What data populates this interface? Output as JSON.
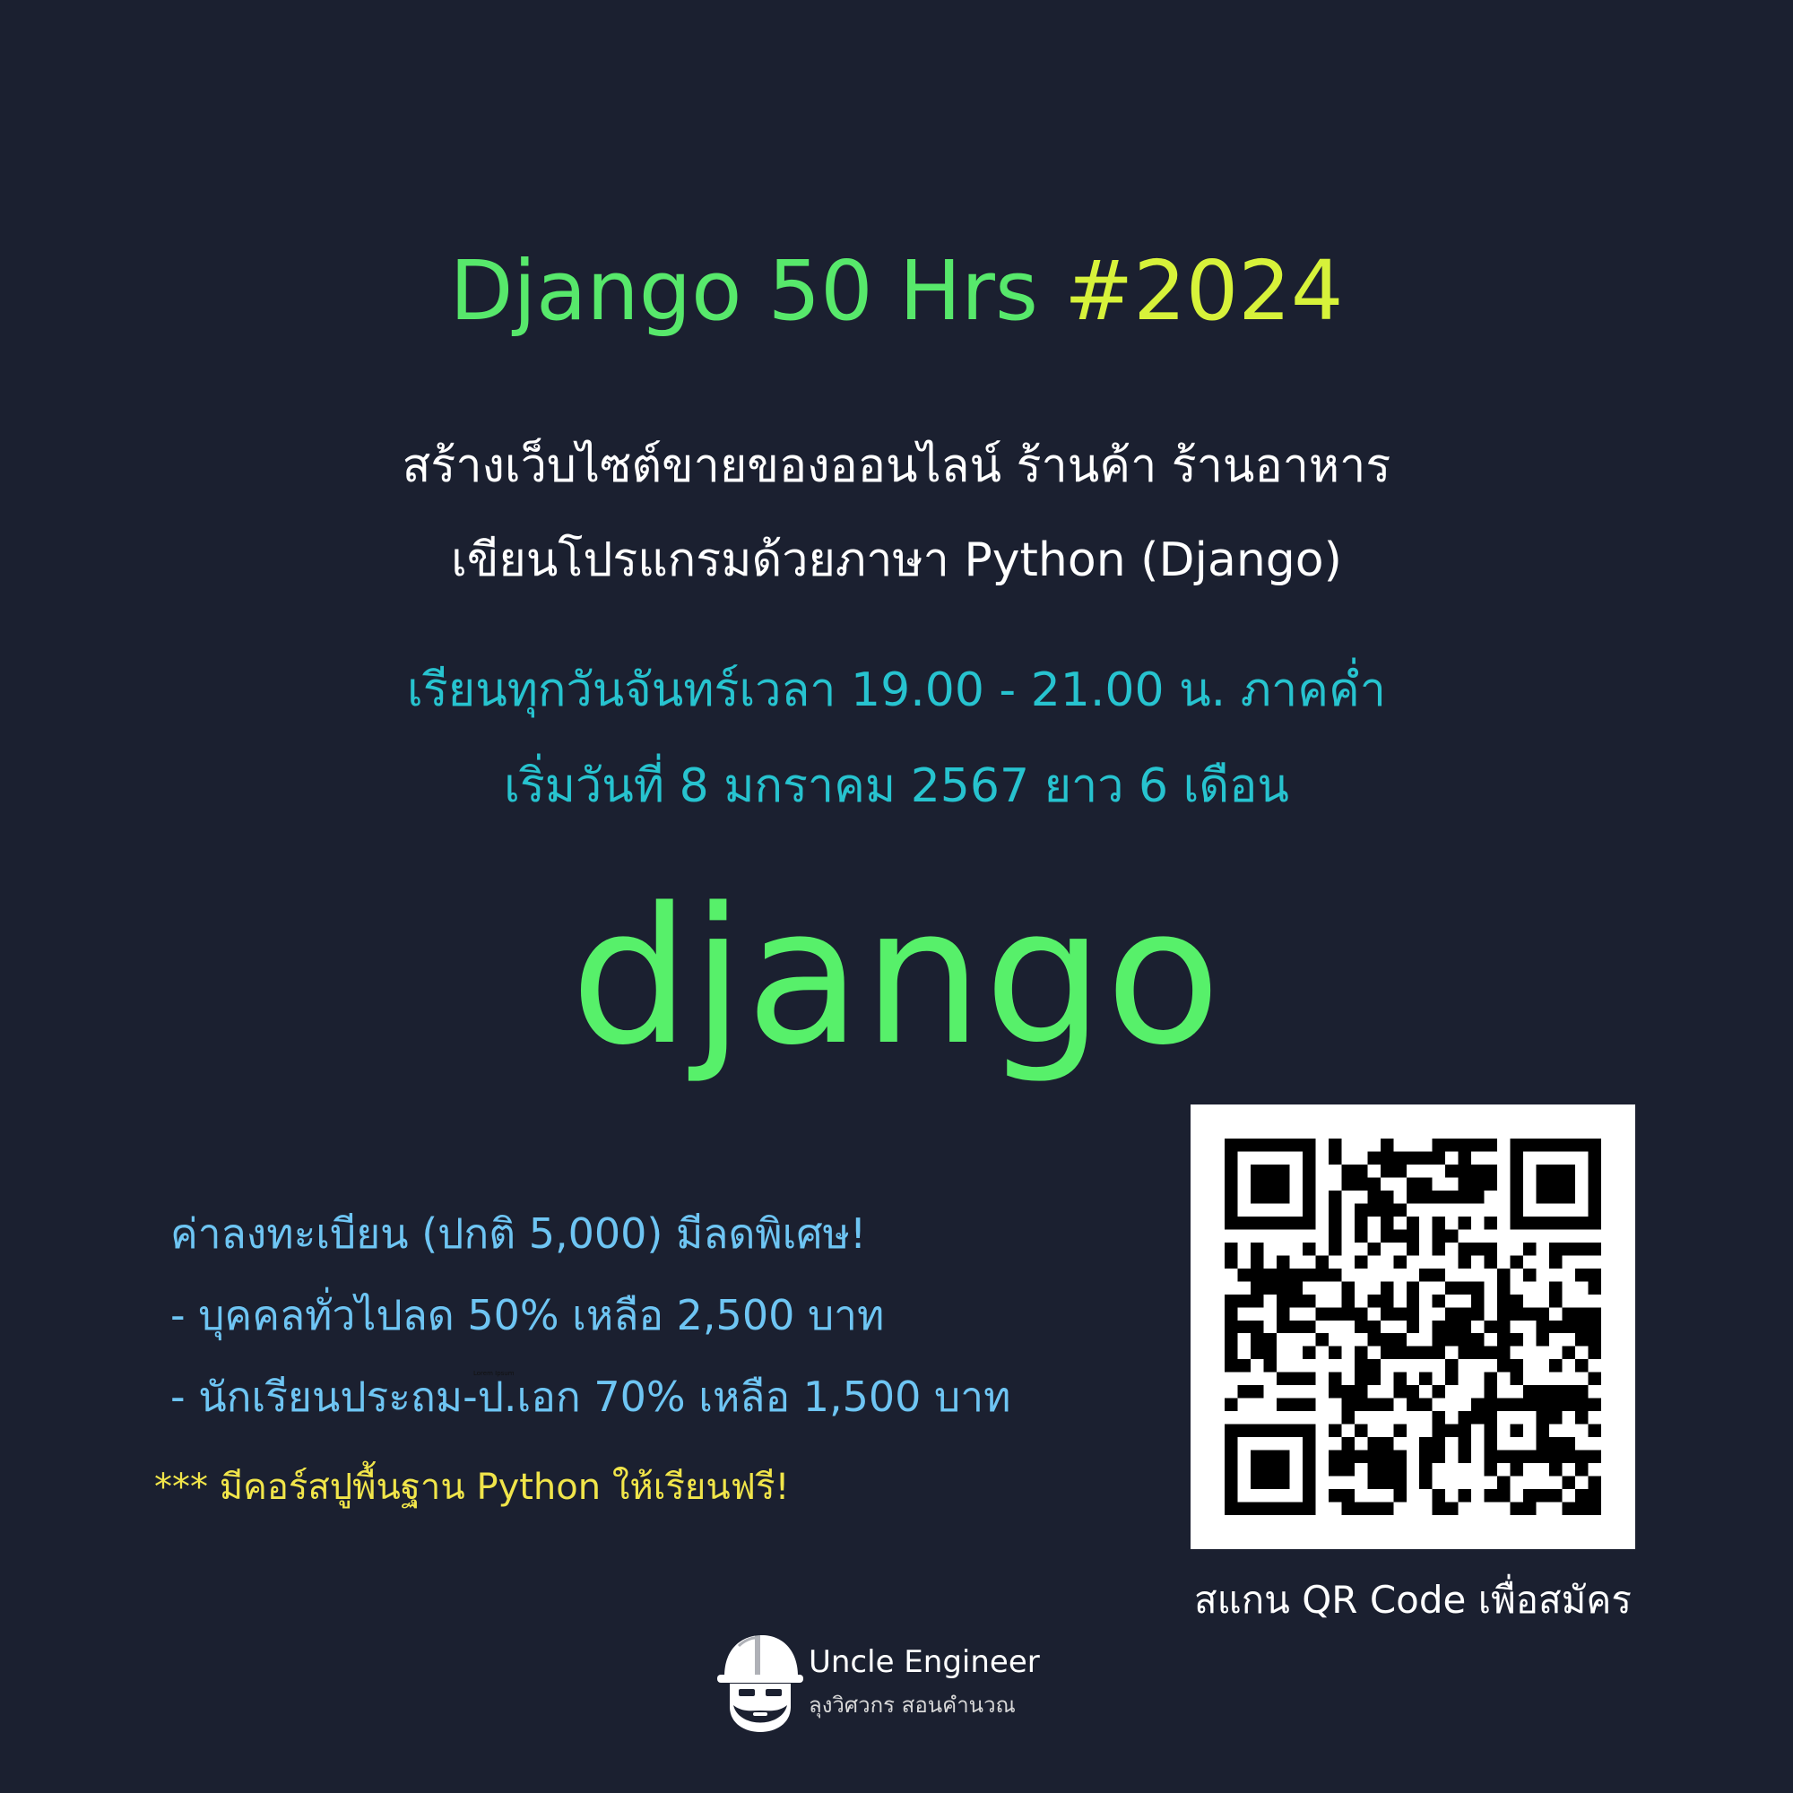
{
  "header": {
    "title_part1": "Django 50 Hrs",
    "title_part2": "#2024"
  },
  "description": {
    "line1": "สร้างเว็บไซต์ขายของออนไลน์ ร้านค้า ร้านอาหาร",
    "line2": "เขียนโปรแกรมด้วยภาษา Python (Django)"
  },
  "schedule": {
    "line1": "เรียนทุกวันจันทร์เวลา 19.00 - 21.00 น. ภาคค่ำ",
    "line2": "เริ่มวันที่ 8 มกราคม 2567 ยาว 6 เดือน"
  },
  "logo": {
    "text": "django"
  },
  "pricing": {
    "heading": "ค่าลงทะเบียน (ปกติ 5,000) มีลดพิเศษ!",
    "item1": "- บุคคลทั่วไปลด 50% เหลือ 2,500 บาท",
    "item2": "- นักเรียนประถม-ป.เอก 70% เหลือ 1,500 บาท",
    "tiny_note": "Lorem Ipsum"
  },
  "bonus": {
    "text": "*** มีคอร์สปูพื้นฐาน Python ให้เรียนฟรี!"
  },
  "qr": {
    "caption": "สแกน QR Code เพื่อสมัคร"
  },
  "brand": {
    "name": "Uncle Engineer",
    "subtitle": "ลุงวิศวกร สอนคำนวณ",
    "icon": "engineer-helmet-icon"
  },
  "colors": {
    "background": "#1b2030",
    "title_green": "#57e86b",
    "title_yellow": "#d7f23a",
    "teal": "#27c3cf",
    "django_green": "#57f06a",
    "price_blue": "#6ec5f3",
    "bonus_yellow": "#f1e54a"
  }
}
